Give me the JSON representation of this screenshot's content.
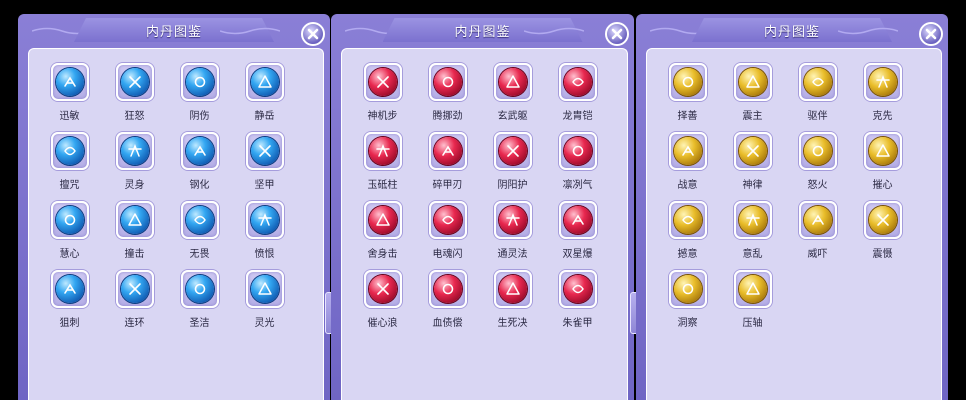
{
  "panels": [
    {
      "title": "内丹图鉴",
      "theme": "blue",
      "items": [
        "迅敏",
        "狂怒",
        "阴伤",
        "静岳",
        "擅咒",
        "灵身",
        "钢化",
        "坚甲",
        "慧心",
        "撞击",
        "无畏",
        "愤恨",
        "狙刺",
        "连环",
        "圣洁",
        "灵光"
      ]
    },
    {
      "title": "内丹图鉴",
      "theme": "red",
      "items": [
        "神机步",
        "腾挪劲",
        "玄武躯",
        "龙胄铠",
        "玉砥柱",
        "碎甲刃",
        "阴阳护",
        "凛冽气",
        "舍身击",
        "电魂闪",
        "通灵法",
        "双星爆",
        "催心浪",
        "血债偿",
        "生死决",
        "朱雀甲"
      ]
    },
    {
      "title": "内丹图鉴",
      "theme": "gold",
      "items": [
        "择善",
        "震主",
        "驱伴",
        "克先",
        "战意",
        "神律",
        "怒火",
        "摧心",
        "撼意",
        "意乱",
        "威吓",
        "震慑",
        "洞察",
        "压轴"
      ]
    }
  ],
  "colors": {
    "blue": "#1f7fd6",
    "red": "#d81f45",
    "gold": "#e0b020",
    "panel": "#7c72cf",
    "inner": "#d9d6f3"
  },
  "icons": {
    "close": "close-icon"
  }
}
